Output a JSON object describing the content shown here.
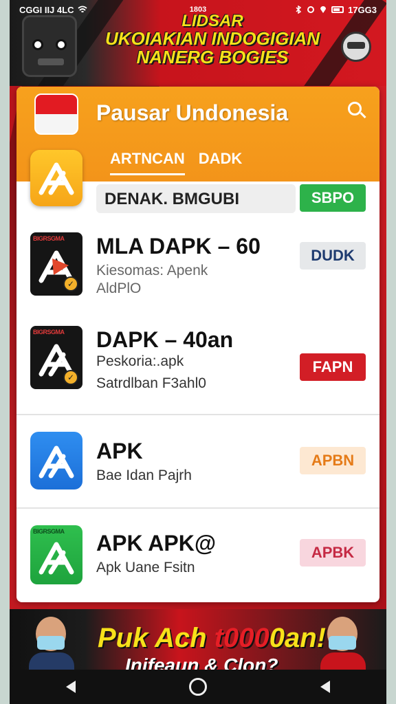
{
  "statusbar": {
    "left_text": "CGGI IIJ 4LC",
    "time": "1803",
    "right_text": "17GG3"
  },
  "top_banner": {
    "line1": "LIDSAR",
    "line2": "UKOIAKIAN INDOGIGIAN",
    "line3": "NANERG BOGIES"
  },
  "app": {
    "title": "Pausar Undonesia",
    "tabs": [
      "ARTNCAN",
      "DADK"
    ]
  },
  "list": [
    {
      "name_box": "DENAK. BMGUBI",
      "button": "SBPO",
      "button_bg": "#2db24a",
      "button_color": "#ffffff"
    },
    {
      "icon_tag": "BIGRSGMA",
      "name": "MLA DAPK – 60",
      "sub1": "Kiesomas: Apenk",
      "sub2": "AldPlO",
      "button": "DUDK",
      "button_bg": "#e6e8ea",
      "button_color": "#1e3b70"
    },
    {
      "icon_tag": "BIGRSGMA",
      "name": "DAPK – 40an",
      "sub1": "Peskoria:.apk",
      "sub2": "Satrdlban F3ahl0",
      "button": "FAPN",
      "button_bg": "#d21e26",
      "button_color": "#ffffff"
    },
    {
      "name": "APK",
      "sub1": "Bae Idan Pajrh",
      "button": "APBN",
      "button_bg": "#fde8d2",
      "button_color": "#e57b18"
    },
    {
      "icon_tag": "BIGRSGMA",
      "name": "APK APK@",
      "sub1": "Apk Uane Fsitn",
      "button": "APBK",
      "button_bg": "#f8d6de",
      "button_color": "#c52a44"
    }
  ],
  "bottom_banner": {
    "line1_a": "Puk Ach ",
    "line1_b": "t000",
    "line1_c": "0an!",
    "line2": "Inifeaun & Clon?"
  },
  "icons": {
    "search": "search-icon",
    "flag": "indonesia-flag-icon",
    "back": "back-icon",
    "home": "home-icon"
  }
}
